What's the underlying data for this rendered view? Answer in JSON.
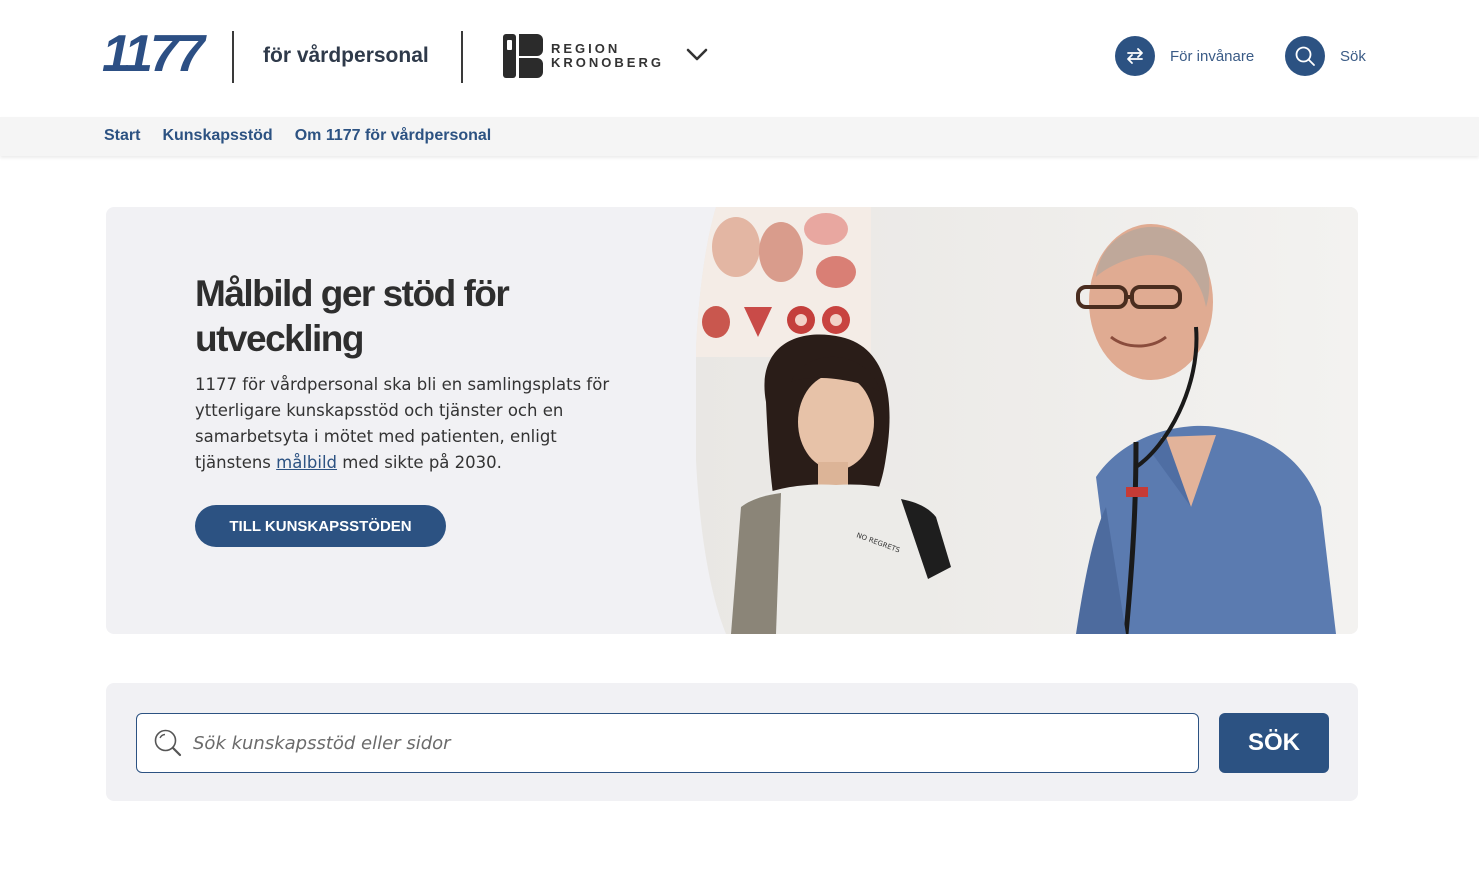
{
  "header": {
    "logo_text": "1177",
    "site_name": "för vårdpersonal",
    "region_line1": "REGION",
    "region_line2": "KRONOBERG",
    "links": {
      "residents_label": "För invånare",
      "search_label": "Sök"
    }
  },
  "nav": {
    "items": [
      {
        "label": "Start"
      },
      {
        "label": "Kunskapsstöd"
      },
      {
        "label": "Om 1177 för vårdpersonal"
      }
    ]
  },
  "hero": {
    "title": "Målbild ger stöd för utveckling",
    "body_before": "1177 för vårdpersonal ska bli en samlingsplats för ytterligare kunskapsstöd och tjänster och en samarbetsyta i mötet med patienten, enligt tjänstens ",
    "body_link": "målbild",
    "body_after": " med sikte på 2030.",
    "button_label": "TILL KUNSKAPSSTÖDEN",
    "tshirt_text": "NO REGRETS"
  },
  "search": {
    "placeholder": "Sök kunskapsstöd eller sidor",
    "value": "",
    "button_label": "SÖK"
  },
  "colors": {
    "brand_blue": "#2c5282",
    "panel_bg": "#f1f1f4",
    "nav_bg": "#f5f5f5"
  }
}
